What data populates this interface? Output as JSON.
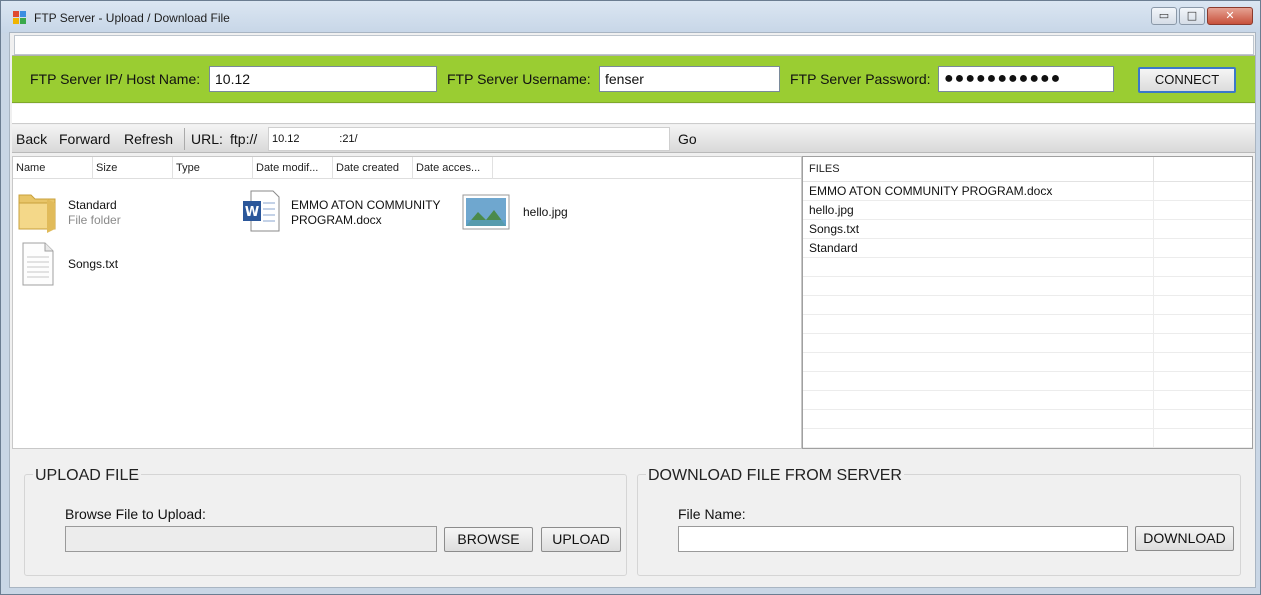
{
  "window": {
    "title": "FTP Server - Upload / Download File",
    "minimize_glyph": "▭",
    "maximize_glyph": "□",
    "close_glyph": "✕"
  },
  "connection": {
    "host_label": "FTP Server IP/ Host Name:",
    "host_value": "10.12",
    "username_label": "FTP Server Username:",
    "username_value": "fenser",
    "password_label": "FTP Server Password:",
    "password_masked": "●●●●●●●●●●●",
    "connect_label": "CONNECT",
    "accent_color": "#9acd32"
  },
  "nav": {
    "back": "Back",
    "forward": "Forward",
    "refresh": "Refresh",
    "url_label": "URL:",
    "url_scheme": "ftp://",
    "url_value": "10.12             :21/",
    "go": "Go"
  },
  "explorer": {
    "columns": [
      "Name",
      "Size",
      "Type",
      "Date modif...",
      "Date created",
      "Date acces..."
    ],
    "items": [
      {
        "name": "Standard",
        "subtitle": "File folder",
        "icon": "folder-icon"
      },
      {
        "name_line1": "EMMO ATON COMMUNITY",
        "name_line2": "PROGRAM.docx",
        "icon": "word-document-icon"
      },
      {
        "name": "hello.jpg",
        "icon": "image-file-icon"
      },
      {
        "name": "Songs.txt",
        "icon": "text-file-icon"
      }
    ]
  },
  "files_panel": {
    "header": "FILES",
    "rows": [
      "EMMO ATON COMMUNITY PROGRAM.docx",
      "hello.jpg",
      "Songs.txt",
      "Standard"
    ]
  },
  "upload": {
    "title": "UPLOAD FILE",
    "label": "Browse File to Upload:",
    "file_value": "",
    "browse": "BROWSE",
    "upload": "UPLOAD"
  },
  "download": {
    "title": "DOWNLOAD FILE FROM SERVER",
    "label": "File Name:",
    "file_value": "",
    "download": "DOWNLOAD"
  }
}
